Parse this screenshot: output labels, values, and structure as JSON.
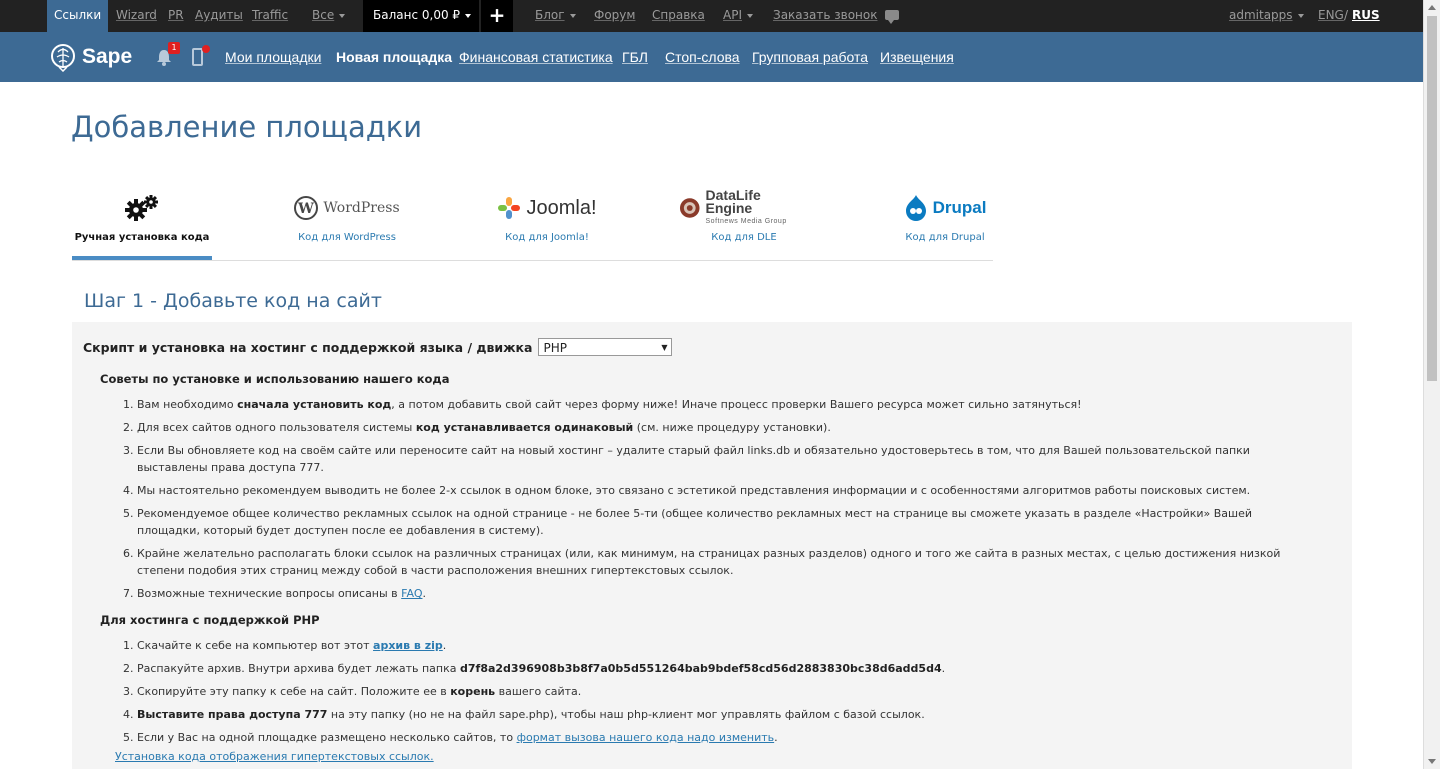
{
  "topbar": {
    "links": "Ссылки",
    "wizard": "Wizard",
    "pr": "PR",
    "audits": "Аудиты",
    "traffic": "Traffic",
    "all": "Все",
    "balance": "Баланс  0,00 ₽",
    "plus": "+",
    "blog": "Блог",
    "forum": "Форум",
    "help": "Справка",
    "api": "API",
    "callback": "Заказать звонок",
    "user": "admitapps",
    "lang_eng": "ENG",
    "lang_sep": "/",
    "lang_rus": "RUS"
  },
  "header": {
    "logo": "Sape",
    "notif_count": "1",
    "nav": {
      "my_sites": "Мои площадки",
      "new_site": "Новая площадка",
      "finance": "Финансовая статистика",
      "gbl": "ГБЛ",
      "stopwords": "Стоп-слова",
      "group": "Групповая работа",
      "notices": "Извещения"
    }
  },
  "page_title": "Добавление площадки",
  "tabs": {
    "manual": "Ручная установка кода",
    "wordpress_logo": "WordPress",
    "wordpress": "Код для WordPress",
    "joomla_logo": "Joomla!",
    "joomla": "Код для Joomla!",
    "dle_logo": "DataLife Engine",
    "dle_sub": "Softnews Media Group",
    "dle": "Код для DLE",
    "drupal_logo": "Drupal",
    "drupal": "Код для Drupal"
  },
  "step_title": "Шаг 1 - Добавьте код на сайт",
  "script_label": "Скрипт и установка на хостинг с поддержкой языка / движка",
  "script_value": "PHP",
  "tips_title": "Советы по установке и использованию нашего кода",
  "tips": {
    "t1a": "Вам необходимо ",
    "t1b": "сначала установить код",
    "t1c": ", а потом добавить свой сайт через форму ниже! Иначе процесс проверки Вашего ресурса может сильно затянуться!",
    "t2a": "Для всех сайтов одного пользователя системы ",
    "t2b": "код устанавливается одинаковый",
    "t2c": " (см. ниже процедуру установки).",
    "t3": "Если Вы обновляете код на своём сайте или переносите сайт на новый хостинг – удалите старый файл links.db и обязательно удостоверьтесь в том, что для Вашей пользовательской папки выставлены права доступа 777.",
    "t4": "Мы настоятельно рекомендуем выводить не более 2-х ссылок в одном блоке, это связано с эстетикой представления информации и с особенностями алгоритмов работы поисковых систем.",
    "t5": "Рекомендуемое общее количество рекламных ссылок на одной странице - не более 5-ти (общее количество рекламных мест на странице вы сможете указать в разделе «Настройки» Вашей площадки, который будет доступен после ее добавления в систему).",
    "t6": "Крайне желательно располагать блоки ссылок на различных страницах (или, как минимум, на страницах разных разделов) одного и того же сайта в разных местах, с целью достижения низкой степени подобия этих страниц между собой в части расположения внешних гипертекстовых ссылок.",
    "t7a": "Возможные технические вопросы описаны в ",
    "t7b": "FAQ",
    "t7c": "."
  },
  "php_title": "Для хостинга с поддержкой PHP",
  "php": {
    "s1a": "Скачайте к себе на компьютер вот этот ",
    "s1b": "архив в zip",
    "s1c": ".",
    "s2a": "Распакуйте архив. Внутри архива будет лежать папка ",
    "s2b": "d7f8a2d396908b3b8f7a0b5d551264bab9bdef58cd56d2883830bc38d6add5d4",
    "s2c": ".",
    "s3a": "Скопируйте эту папку к себе на сайт. Положите ее в ",
    "s3b": "корень",
    "s3c": " вашего сайта.",
    "s4a": "Выставите права доступа 777",
    "s4b": " на эту папку (но не на файл sape.php), чтобы наш php-клиент мог управлять файлом с базой ссылок.",
    "s5a": "Если у Вас на одной площадке размещено несколько сайтов, то ",
    "s5b": "формат вызова нашего кода надо изменить",
    "s5c": "."
  },
  "footer_link": "Установка кода отображения гипертекстовых ссылок."
}
